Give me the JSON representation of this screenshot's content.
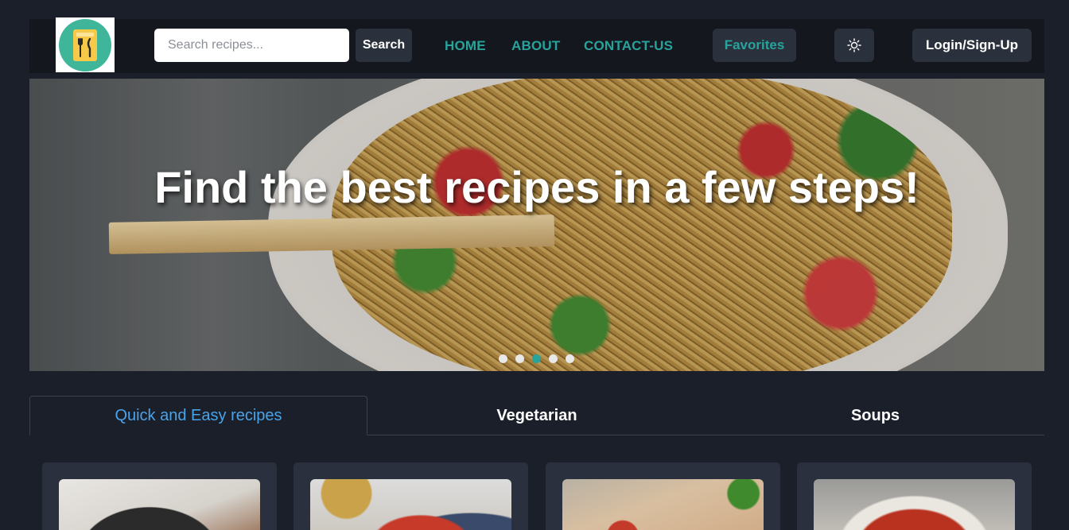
{
  "navbar": {
    "search_placeholder": "Search recipes...",
    "search_label": "Search",
    "links": [
      "HOME",
      "ABOUT",
      "CONTACT-US"
    ],
    "favorites_label": "Favorites",
    "login_label": "Login/Sign-Up",
    "logo_icon": "cutlery-icon",
    "theme_icon": "sun-icon"
  },
  "hero": {
    "title": "Find the best recipes in a few steps!",
    "slide_count": 5,
    "active_slide": 3
  },
  "tabs": [
    {
      "label": "Quick and Easy recipes",
      "active": true
    },
    {
      "label": "Vegetarian",
      "active": false
    },
    {
      "label": "Soups",
      "active": false
    }
  ],
  "colors": {
    "background": "#1b1f2a",
    "accent": "#27a39b",
    "active_tab": "#4aa3e8",
    "button_bg": "#2b313c"
  }
}
